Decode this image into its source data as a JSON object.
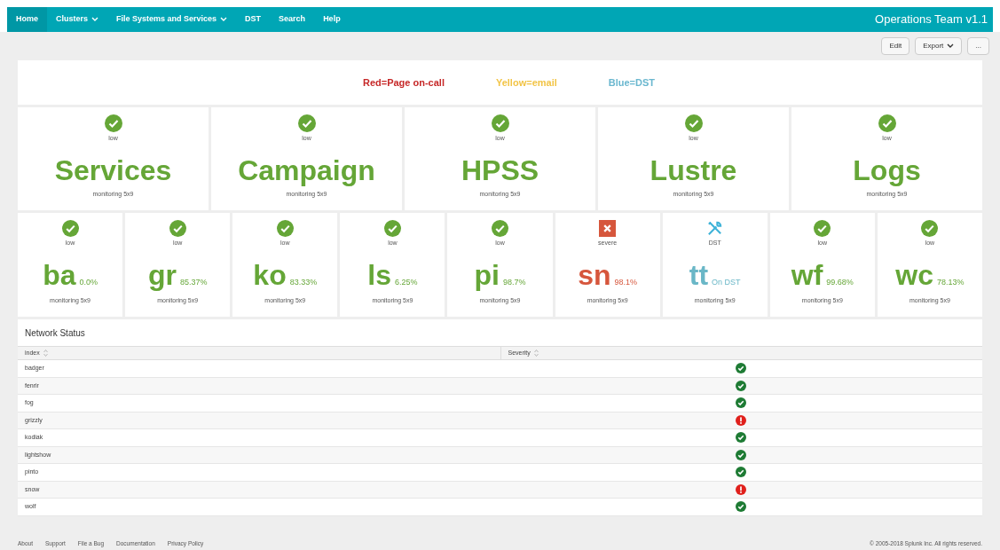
{
  "nav": {
    "items": [
      {
        "label": "Home",
        "selected": true,
        "dropdown": false
      },
      {
        "label": "Clusters",
        "selected": false,
        "dropdown": true
      },
      {
        "label": "File Systems and Services",
        "selected": false,
        "dropdown": true
      },
      {
        "label": "DST",
        "selected": false,
        "dropdown": false
      },
      {
        "label": "Search",
        "selected": false,
        "dropdown": false
      },
      {
        "label": "Help",
        "selected": false,
        "dropdown": false
      }
    ],
    "app_title": "Operations Team v1.1"
  },
  "toolbar": [
    {
      "label": "Edit",
      "dropdown": false
    },
    {
      "label": "Export",
      "dropdown": true
    },
    {
      "label": "...",
      "dropdown": false
    }
  ],
  "legend": [
    {
      "text": "Red=Page on-call",
      "color": "#c62828"
    },
    {
      "text": "Yellow=email",
      "color": "#f2c446"
    },
    {
      "text": "Blue=DST",
      "color": "#6ab7cf"
    }
  ],
  "big_tiles": [
    {
      "name": "Services",
      "status": "low",
      "kind": "low",
      "caption": "monitoring 5x9"
    },
    {
      "name": "Campaign",
      "status": "low",
      "kind": "low",
      "caption": "monitoring 5x9"
    },
    {
      "name": "HPSS",
      "status": "low",
      "kind": "low",
      "caption": "monitoring 5x9"
    },
    {
      "name": "Lustre",
      "status": "low",
      "kind": "low",
      "caption": "monitoring 5x9"
    },
    {
      "name": "Logs",
      "status": "low",
      "kind": "low",
      "caption": "monitoring 5x9"
    }
  ],
  "small_tiles": [
    {
      "name": "ba",
      "value": "0.0%",
      "status": "low",
      "kind": "low",
      "caption": "monitoring 5x9"
    },
    {
      "name": "gr",
      "value": "85.37%",
      "status": "low",
      "kind": "low",
      "caption": "monitoring 5x9"
    },
    {
      "name": "ko",
      "value": "83.33%",
      "status": "low",
      "kind": "low",
      "caption": "monitoring 5x9"
    },
    {
      "name": "ls",
      "value": "6.25%",
      "status": "low",
      "kind": "low",
      "caption": "monitoring 5x9"
    },
    {
      "name": "pi",
      "value": "98.7%",
      "status": "low",
      "kind": "low",
      "caption": "monitoring 5x9"
    },
    {
      "name": "sn",
      "value": "98.1%",
      "status": "severe",
      "kind": "severe",
      "caption": "monitoring 5x9"
    },
    {
      "name": "tt",
      "value": "On DST",
      "status": "DST",
      "kind": "dst",
      "caption": "monitoring 5x9"
    },
    {
      "name": "wf",
      "value": "99.68%",
      "status": "low",
      "kind": "low",
      "caption": "monitoring 5x9"
    },
    {
      "name": "wc",
      "value": "78.13%",
      "status": "low",
      "kind": "low",
      "caption": "monitoring 5x9"
    }
  ],
  "network_status": {
    "title": "Network Status",
    "columns": [
      "index",
      "Severity"
    ],
    "rows": [
      {
        "index": "badger",
        "kind": "ok"
      },
      {
        "index": "fenrir",
        "kind": "ok"
      },
      {
        "index": "fog",
        "kind": "ok"
      },
      {
        "index": "grizzly",
        "kind": "critical"
      },
      {
        "index": "kodiak",
        "kind": "ok"
      },
      {
        "index": "lightshow",
        "kind": "ok"
      },
      {
        "index": "pinto",
        "kind": "ok"
      },
      {
        "index": "snow",
        "kind": "critical"
      },
      {
        "index": "wolf",
        "kind": "ok"
      }
    ]
  },
  "footer": {
    "links": [
      "About",
      "Support",
      "File a Bug",
      "Documentation",
      "Privacy Policy"
    ],
    "copyright": "© 2005-2018 Splunk Inc. All rights reserved."
  }
}
